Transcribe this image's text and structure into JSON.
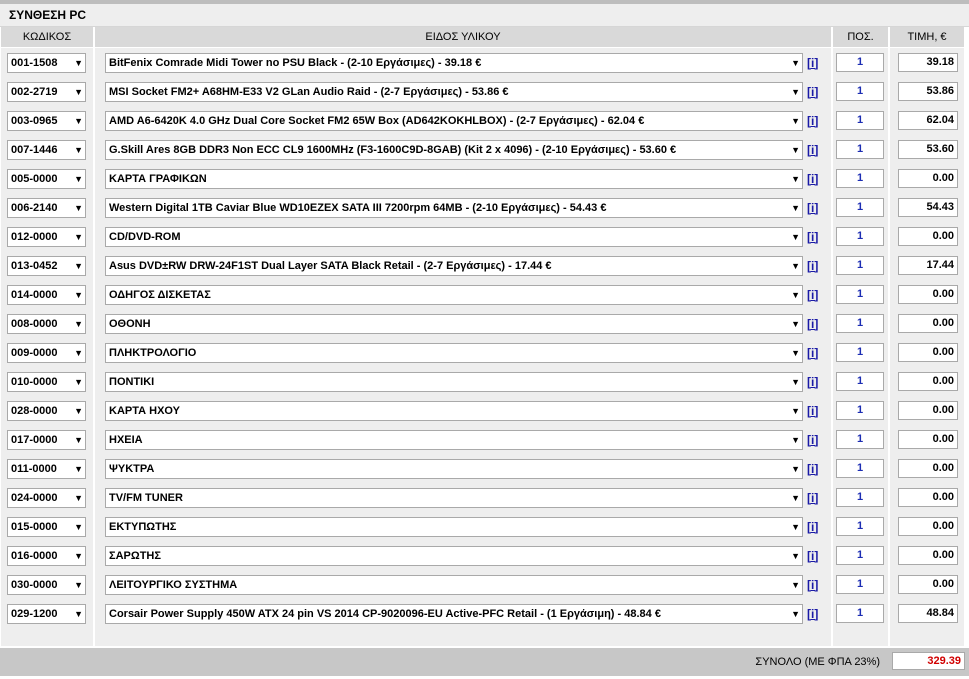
{
  "title": "ΣΥΝΘΕΣΗ PC",
  "headers": {
    "code": "ΚΩΔΙΚΟΣ",
    "desc": "ΕΙΔΟΣ ΥΛΙΚΟΥ",
    "qty": "ΠΟΣ.",
    "price": "ΤΙΜΗ, €"
  },
  "info_label": "[i]",
  "dropdown_arrow": "▼",
  "rows": [
    {
      "code": "001-1508",
      "desc": "BitFenix Comrade Midi Tower no PSU Black - (2-10 Εργάσιμες) - 39.18 €",
      "qty": "1",
      "price": "39.18"
    },
    {
      "code": "002-2719",
      "desc": "MSI Socket FM2+ A68HM-E33 V2 GLan Audio Raid - (2-7 Εργάσιμες) - 53.86 €",
      "qty": "1",
      "price": "53.86"
    },
    {
      "code": "003-0965",
      "desc": "AMD A6-6420K 4.0 GHz Dual Core Socket FM2 65W Box (AD642KOKHLBOX) - (2-7 Εργάσιμες) - 62.04 €",
      "qty": "1",
      "price": "62.04"
    },
    {
      "code": "007-1446",
      "desc": "G.Skill Ares 8GB DDR3 Non ECC CL9 1600MHz (F3-1600C9D-8GAB) (Kit 2 x 4096) - (2-10 Εργάσιμες) - 53.60 €",
      "qty": "1",
      "price": "53.60"
    },
    {
      "code": "005-0000",
      "desc": "ΚΑΡΤΑ ΓΡΑΦΙΚΩΝ",
      "qty": "1",
      "price": "0.00"
    },
    {
      "code": "006-2140",
      "desc": "Western Digital 1TB Caviar Blue WD10EZEX SATA III 7200rpm 64MB - (2-10 Εργάσιμες) - 54.43 €",
      "qty": "1",
      "price": "54.43"
    },
    {
      "code": "012-0000",
      "desc": "CD/DVD-ROM",
      "qty": "1",
      "price": "0.00"
    },
    {
      "code": "013-0452",
      "desc": "Asus DVD±RW DRW-24F1ST Dual Layer SATA Black Retail - (2-7 Εργάσιμες) - 17.44 €",
      "qty": "1",
      "price": "17.44"
    },
    {
      "code": "014-0000",
      "desc": "ΟΔΗΓΟΣ ΔΙΣΚΕΤΑΣ",
      "qty": "1",
      "price": "0.00"
    },
    {
      "code": "008-0000",
      "desc": "ΟΘΟΝΗ",
      "qty": "1",
      "price": "0.00"
    },
    {
      "code": "009-0000",
      "desc": "ΠΛΗΚΤΡΟΛΟΓΙΟ",
      "qty": "1",
      "price": "0.00"
    },
    {
      "code": "010-0000",
      "desc": "ΠΟΝΤΙΚΙ",
      "qty": "1",
      "price": "0.00"
    },
    {
      "code": "028-0000",
      "desc": "ΚΑΡΤΑ ΗΧΟΥ",
      "qty": "1",
      "price": "0.00"
    },
    {
      "code": "017-0000",
      "desc": "ΗΧΕΙΑ",
      "qty": "1",
      "price": "0.00"
    },
    {
      "code": "011-0000",
      "desc": "ΨΥΚΤΡΑ",
      "qty": "1",
      "price": "0.00"
    },
    {
      "code": "024-0000",
      "desc": "TV/FM TUNER",
      "qty": "1",
      "price": "0.00"
    },
    {
      "code": "015-0000",
      "desc": "ΕΚΤΥΠΩΤΗΣ",
      "qty": "1",
      "price": "0.00"
    },
    {
      "code": "016-0000",
      "desc": "ΣΑΡΩΤΗΣ",
      "qty": "1",
      "price": "0.00"
    },
    {
      "code": "030-0000",
      "desc": "ΛΕΙΤΟΥΡΓΙΚΟ ΣΥΣΤΗΜΑ",
      "qty": "1",
      "price": "0.00"
    },
    {
      "code": "029-1200",
      "desc": "Corsair Power Supply 450W ATX 24 pin VS 2014 CP-9020096-EU Active-PFC Retail - (1 Εργάσιμη) - 48.84 €",
      "qty": "1",
      "price": "48.84"
    }
  ],
  "footer": {
    "total_label": "ΣΥΝΟΛΟ (ΜΕ ΦΠΑ 23%)",
    "total_value": "329.39"
  },
  "colors": {
    "total": "#d10000",
    "qty": "#1c2db3",
    "info": "#1a1aa6"
  }
}
